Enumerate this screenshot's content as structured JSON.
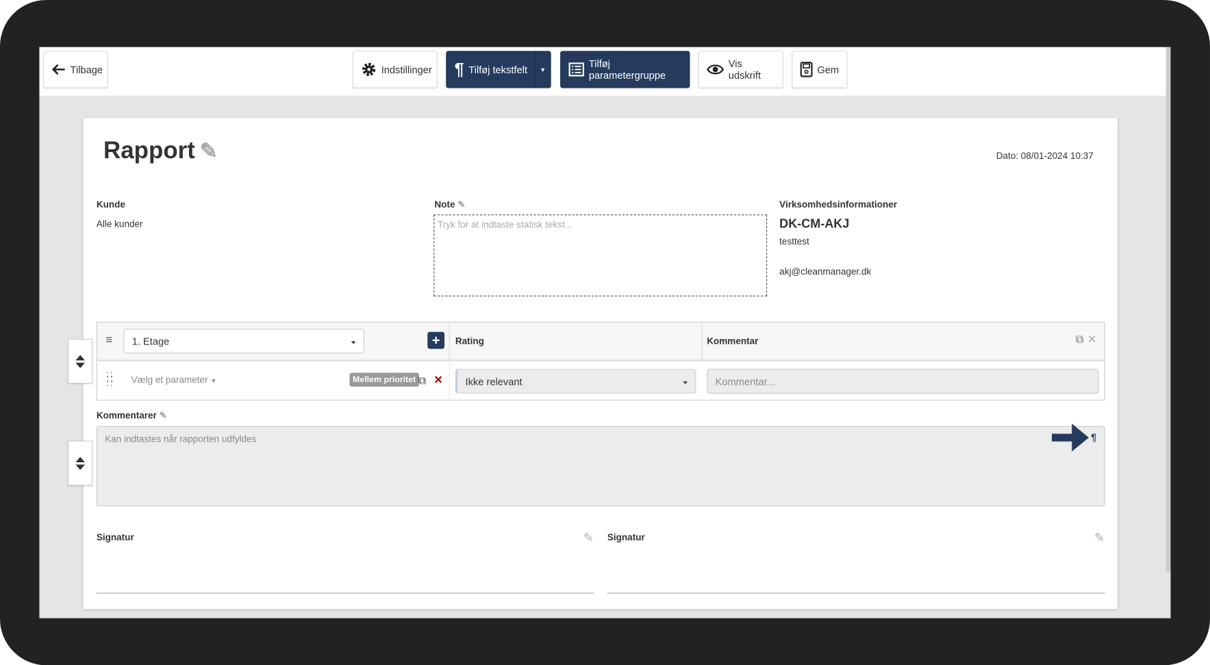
{
  "toolbar": {
    "back": "Tilbage",
    "settings": "Indstillinger",
    "add_textfield": "Tilføj tekstfelt",
    "add_paramgroup": "Tilføj parametergruppe",
    "print": "Vis udskrift",
    "save": "Gem"
  },
  "report": {
    "title": "Rapport",
    "date": "Dato: 08/01-2024 10:37",
    "customer_label": "Kunde",
    "customer_value": "Alle kunder",
    "note_label": "Note",
    "note_placeholder": "Tryk for at indtaste statisk tekst...",
    "company_label": "Virksomhedsinformationer",
    "company_name": "DK-CM-AKJ",
    "company_line": "testtest",
    "company_email": "akj@cleanmanager.dk"
  },
  "table": {
    "group_select": "1. Etage",
    "col_rating": "Rating",
    "col_comment": "Kommentar",
    "row": {
      "param_placeholder": "Vælg et parameter",
      "priority": "Mellem prioritet",
      "rating": "Ikke relevant",
      "comment_placeholder": "Kommentar..."
    }
  },
  "comments": {
    "label": "Kommentarer",
    "placeholder": "Kan indtastes når rapporten udfyldes"
  },
  "signatures": [
    {
      "label": "Signatur"
    },
    {
      "label": "Signatur"
    }
  ],
  "colors": {
    "primary": "#243b5e",
    "danger": "#a00000"
  }
}
